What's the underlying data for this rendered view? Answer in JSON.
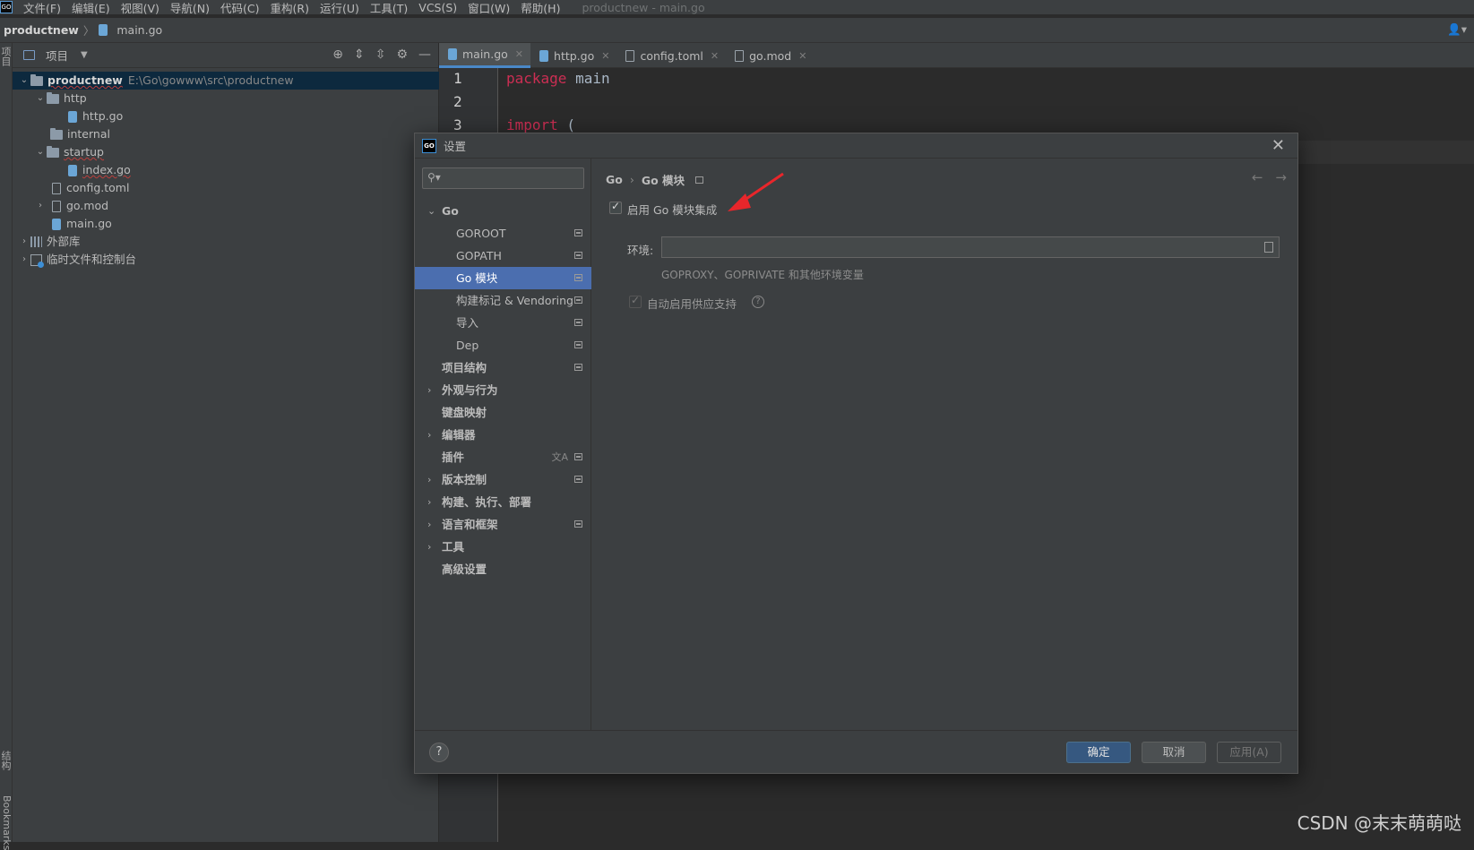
{
  "menubar": {
    "items": [
      "文件(F)",
      "编辑(E)",
      "视图(V)",
      "导航(N)",
      "代码(C)",
      "重构(R)",
      "运行(U)",
      "工具(T)",
      "VCS(S)",
      "窗口(W)",
      "帮助(H)"
    ],
    "window_title": "productnew - main.go"
  },
  "navbar": {
    "project": "productnew",
    "file": "main.go"
  },
  "leftstrip": {
    "project_label": "项目",
    "structure_label": "结构",
    "bookmarks_label": "Bookmarks"
  },
  "project_panel": {
    "title": "项目",
    "tree": [
      {
        "label": "productnew",
        "path": "E:\\Go\\gowww\\src\\productnew",
        "type": "folder",
        "level": 0,
        "expanded": true
      },
      {
        "label": "http",
        "type": "folder",
        "level": 1,
        "expanded": true
      },
      {
        "label": "http.go",
        "type": "go",
        "level": 2
      },
      {
        "label": "internal",
        "type": "folder",
        "level": 1
      },
      {
        "label": "startup",
        "type": "folder",
        "level": 1,
        "expanded": true
      },
      {
        "label": "index.go",
        "type": "go",
        "level": 2
      },
      {
        "label": "config.toml",
        "type": "file",
        "level": 1
      },
      {
        "label": "go.mod",
        "type": "file",
        "level": 1,
        "collapsed": true
      },
      {
        "label": "main.go",
        "type": "go",
        "level": 1
      },
      {
        "label": "外部库",
        "type": "lib",
        "level": 0,
        "collapsed": true
      },
      {
        "label": "临时文件和控制台",
        "type": "scratch",
        "level": 0,
        "collapsed": true
      }
    ]
  },
  "editor": {
    "tabs": [
      {
        "label": "main.go",
        "active": true
      },
      {
        "label": "http.go"
      },
      {
        "label": "config.toml"
      },
      {
        "label": "go.mod"
      }
    ],
    "lines": [
      "1",
      "2",
      "3"
    ],
    "code": {
      "l1_kw": "package",
      "l1_rest": " main",
      "l3_kw": "import",
      "l3_rest": " ("
    }
  },
  "dialog": {
    "title": "设置",
    "logo": "GO",
    "sidebar": [
      {
        "label": "Go",
        "arrow": "⌄",
        "bold": true
      },
      {
        "label": "GOROOT",
        "indent": 2,
        "marker": true
      },
      {
        "label": "GOPATH",
        "indent": 2,
        "marker": true
      },
      {
        "label": "Go 模块",
        "indent": 2,
        "marker": true,
        "selected": true
      },
      {
        "label": "构建标记 & Vendoring",
        "indent": 2,
        "marker": true
      },
      {
        "label": "导入",
        "indent": 2,
        "marker": true
      },
      {
        "label": "Dep",
        "indent": 2,
        "marker": true
      },
      {
        "label": "项目结构",
        "indent": 1,
        "marker": true,
        "bold": true
      },
      {
        "label": "外观与行为",
        "arrow": "›",
        "bold": true
      },
      {
        "label": "键盘映射",
        "indent": 1,
        "bold": true
      },
      {
        "label": "编辑器",
        "arrow": "›",
        "bold": true
      },
      {
        "label": "插件",
        "indent": 1,
        "marker": true,
        "translate": true,
        "bold": true
      },
      {
        "label": "版本控制",
        "arrow": "›",
        "marker": true,
        "bold": true
      },
      {
        "label": "构建、执行、部署",
        "arrow": "›",
        "bold": true
      },
      {
        "label": "语言和框架",
        "arrow": "›",
        "marker": true,
        "bold": true
      },
      {
        "label": "工具",
        "arrow": "›",
        "bold": true
      },
      {
        "label": "高级设置",
        "indent": 1,
        "bold": true
      }
    ],
    "breadcrumb": {
      "parent": "Go",
      "current": "Go 模块"
    },
    "enable_label": "启用 Go 模块集成",
    "env_label": "环境:",
    "env_value": "",
    "env_hint": "GOPROXY、GOPRIVATE 和其他环境变量",
    "vendor_label": "自动启用供应支持",
    "buttons": {
      "ok": "确定",
      "cancel": "取消",
      "apply": "应用(A)",
      "help": "?"
    }
  },
  "watermark": "CSDN @末末萌萌哒",
  "colors": {
    "accent": "#4b6eaf",
    "keyword": "#cc2e53",
    "annotation": "#e8262b"
  }
}
